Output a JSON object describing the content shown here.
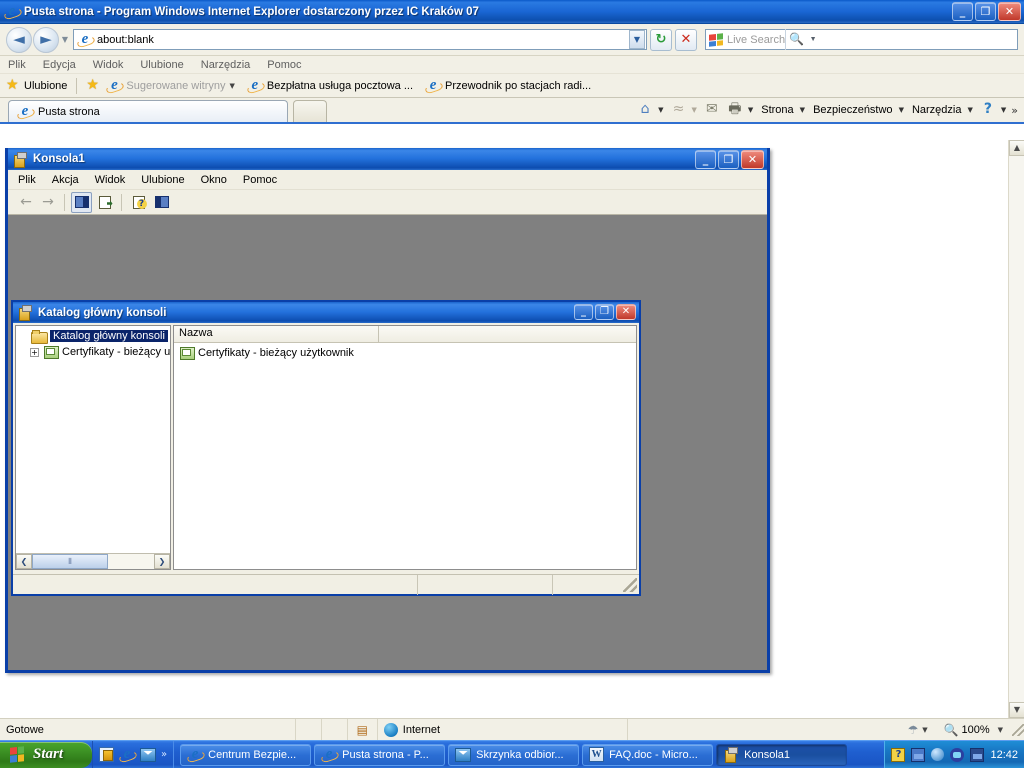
{
  "browser": {
    "title": "Pusta strona - Program Windows Internet Explorer dostarczony przez IC Kraków 07",
    "icon": "ie-logo-icon",
    "caption_buttons": {
      "minimize": "_",
      "restore": "❐",
      "close": "✕"
    },
    "address": {
      "value": "about:blank",
      "icon": "ie-logo-icon",
      "dropdown": "▼"
    },
    "nav": {
      "back": "◄",
      "forward": "►",
      "history_dropdown": "▼",
      "refresh": "↻",
      "stop": "✕"
    },
    "search": {
      "placeholder": "Live Search",
      "value": "",
      "go": "🔍",
      "dropdown": "▼"
    },
    "menu": [
      "Plik",
      "Edycja",
      "Widok",
      "Ulubione",
      "Narzędzia",
      "Pomoc"
    ],
    "favorites_bar": {
      "favorites_label": "Ulubione",
      "add_to_favorites_icon": "add-favorites-icon",
      "items": [
        {
          "label": "Sugerowane witryny",
          "icon": "ie-logo-icon",
          "dimmed": true,
          "caret": "▼"
        },
        {
          "label": "Bezpłatna usługa pocztowa ...",
          "icon": "ie-logo-icon",
          "dimmed": false
        },
        {
          "label": "Przewodnik po stacjach radi...",
          "icon": "ie-logo-icon",
          "dimmed": false
        }
      ]
    },
    "tabs": [
      {
        "label": "Pusta strona",
        "icon": "ie-logo-icon",
        "active": true
      }
    ],
    "new_tab_label": "",
    "command_bar": {
      "home": "⌂",
      "home_caret": "▼",
      "feeds": "≈",
      "feeds_caret": "▼",
      "mail": "✉",
      "print": "🖶",
      "print_caret": "▼",
      "page": "Strona",
      "page_caret": "▼",
      "security": "Bezpieczeństwo",
      "security_caret": "▼",
      "tools": "Narzędzia",
      "tools_caret": "▼",
      "help": "?",
      "help_caret": "▼",
      "overflow": "»"
    },
    "scrollbar": {
      "up": "▲",
      "down": "▼"
    },
    "status_bar": {
      "status": "Gotowe",
      "zone": "Internet",
      "zone_icon": "globe-icon",
      "protected_icon": "protected-mode-icon",
      "privacy_icon": "privacy-report-icon",
      "privacy_caret": "▼",
      "zoom": "100%",
      "zoom_caret": "▼"
    }
  },
  "mmc": {
    "title": "Konsola1",
    "icon": "mmc-console-icon",
    "caption_buttons": {
      "minimize": "_",
      "restore": "❐",
      "close": "✕"
    },
    "menu": [
      "Plik",
      "Akcja",
      "Widok",
      "Ulubione",
      "Okno",
      "Pomoc"
    ],
    "toolbar": {
      "back": "←",
      "forward": "→",
      "show_hide_tree": "show-hide-tree-icon",
      "export_list": "export-list-icon",
      "help": "help-icon",
      "show_hide_action_pane": "show-hide-action-pane-icon"
    },
    "child_window": {
      "title": "Katalog główny konsoli",
      "icon": "mmc-console-icon",
      "caption_buttons": {
        "minimize": "_",
        "restore": "❐",
        "close": "✕"
      },
      "tree": {
        "root": {
          "label": "Katalog główny konsoli",
          "icon": "folder-open-icon",
          "selected": true
        },
        "children": [
          {
            "label": "Certyfikaty - bieżący u",
            "icon": "certificates-icon",
            "expander": "+"
          }
        ]
      },
      "tree_scrollbar": {
        "left": "❮",
        "right": "❯",
        "thumb": "⦀"
      },
      "list": {
        "columns": [
          "Nazwa",
          ""
        ],
        "rows": [
          {
            "name": "Certyfikaty - bieżący użytkownik",
            "icon": "certificates-icon"
          }
        ]
      },
      "status_panes": [
        "",
        "",
        ""
      ]
    }
  },
  "taskbar": {
    "start_label": "Start",
    "start_icon": "windows-flag-icon",
    "quick_launch": [
      {
        "icon": "show-desktop-icon",
        "name": "show-desktop"
      },
      {
        "icon": "ie-logo-icon",
        "name": "internet-explorer"
      },
      {
        "icon": "outlook-icon",
        "name": "outlook"
      }
    ],
    "quick_launch_overflow": "»",
    "tasks": [
      {
        "label": "Centrum Bezpie...",
        "icon": "ie-logo-icon",
        "active": false
      },
      {
        "label": "Pusta strona - P...",
        "icon": "ie-logo-icon",
        "active": false
      },
      {
        "label": "Skrzynka odbior...",
        "icon": "outlook-icon",
        "active": false
      },
      {
        "label": "FAQ.doc - Micro...",
        "icon": "word-icon",
        "active": false
      },
      {
        "label": "Konsola1",
        "icon": "mmc-console-icon",
        "active": true
      }
    ],
    "tray": {
      "icons": [
        "help-icon",
        "updates-icon",
        "security-center-icon",
        "volume-icon",
        "network-icon"
      ],
      "time": "12:42"
    }
  },
  "colors": {
    "title_blue": "#1a64cc",
    "taskbar_blue": "#2a6fdd",
    "start_green": "#3f9526",
    "mdi_gray": "#808080",
    "chrome_beige": "#f1efe4",
    "selection_blue": "#0a246a",
    "close_red": "#c0392b"
  }
}
